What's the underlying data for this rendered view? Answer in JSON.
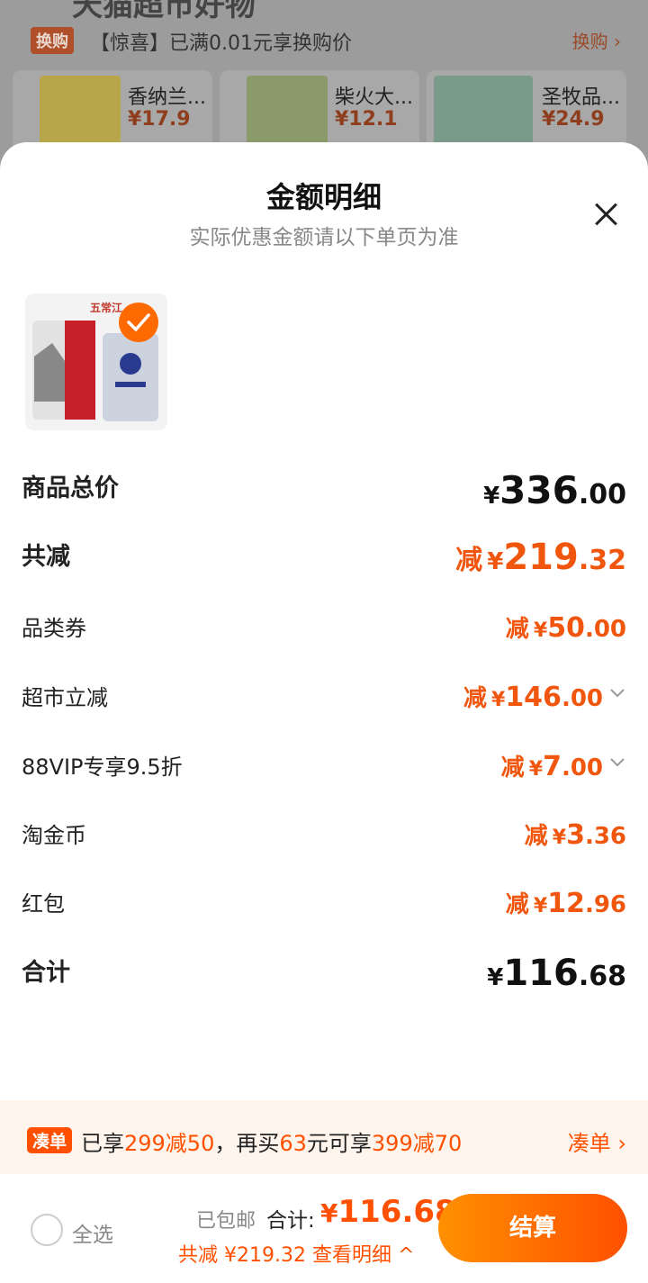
{
  "background": {
    "promo_tag": "换购",
    "promo_text": "【惊喜】已满0.01元享换购价",
    "promo_link": "换购 ›",
    "products": [
      {
        "name": "香纳兰...",
        "price": "¥17.9"
      },
      {
        "name": "柴火大...",
        "price": "¥12.1"
      },
      {
        "name": "圣牧品...",
        "price": "¥24.9"
      }
    ]
  },
  "sheet": {
    "title": "金额明细",
    "subtitle": "实际优惠金额请以下单页为准",
    "product_badge": "五常江"
  },
  "rows": [
    {
      "label": "商品总价",
      "prefix": "",
      "currency": "¥",
      "int": "336",
      "dec": ".00"
    },
    {
      "label": "共减",
      "prefix": "减",
      "currency": "¥",
      "int": "219",
      "dec": ".32"
    },
    {
      "label": "品类券",
      "prefix": "减",
      "currency": "¥",
      "int": "50",
      "dec": ".00"
    },
    {
      "label": "超市立减",
      "prefix": "减",
      "currency": "¥",
      "int": "146",
      "dec": ".00"
    },
    {
      "label": "88VIP专享9.5折",
      "prefix": "减",
      "currency": "¥",
      "int": "7",
      "dec": ".00"
    },
    {
      "label": "淘金币",
      "prefix": "减",
      "currency": "¥",
      "int": "3",
      "dec": ".36"
    },
    {
      "label": "红包",
      "prefix": "减",
      "currency": "¥",
      "int": "12",
      "dec": ".96"
    },
    {
      "label": "合计",
      "prefix": "",
      "currency": "¥",
      "int": "116",
      "dec": ".68"
    }
  ],
  "promo_bar": {
    "tag": "凑单",
    "t1": "已享",
    "t2": "299减50",
    "t3": "，再买",
    "t4": "63",
    "t5": "元可享",
    "t6": "399减70",
    "link": "凑单 ›"
  },
  "footer": {
    "select_all": "全选",
    "shipping": "已包邮",
    "total_label": "合计:",
    "total_currency": "¥",
    "total_value": "116.68",
    "discount_text": "共减 ¥219.32",
    "detail_link": "查看明细 ^",
    "checkout": "结算"
  },
  "colors": {
    "accent": "#ff5000",
    "discount": "#f0560d"
  }
}
